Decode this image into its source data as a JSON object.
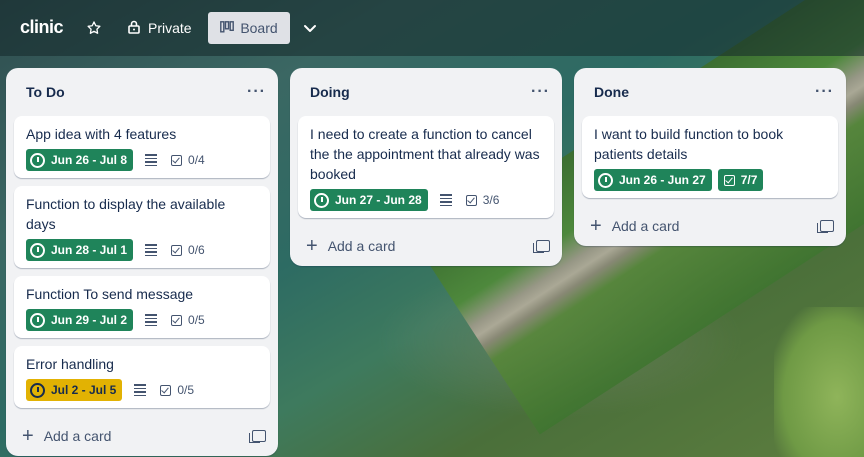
{
  "topbar": {
    "logo": "clinic",
    "private_label": "Private",
    "board_label": "Board"
  },
  "lists": [
    {
      "title": "To Do",
      "add_label": "Add a card",
      "cards": [
        {
          "title": "App idea with 4 features",
          "date": "Jun 26 - Jul 8",
          "checklist": "0/4"
        },
        {
          "title": "Function to display the available days",
          "date": "Jun 28 - Jul 1",
          "checklist": "0/6"
        },
        {
          "title": "Function To send message",
          "date": "Jun 29 - Jul 2",
          "checklist": "0/5"
        },
        {
          "title": "Error handling",
          "date": "Jul 2 - Jul 5",
          "checklist": "0/5"
        }
      ]
    },
    {
      "title": "Doing",
      "add_label": "Add a card",
      "cards": [
        {
          "title": "I need to create a function to cancel the the appointment that already was booked",
          "date": "Jun 27 - Jun 28",
          "checklist": "3/6"
        }
      ]
    },
    {
      "title": "Done",
      "add_label": "Add a card",
      "cards": [
        {
          "title": "I want to build function to book patients details",
          "date": "Jun 26 - Jun 27",
          "checklist": "7/7"
        }
      ]
    }
  ],
  "colors": {
    "date_green": "#1f845a",
    "date_yellow": "#e2b203",
    "list_bg": "#f1f2f4"
  }
}
